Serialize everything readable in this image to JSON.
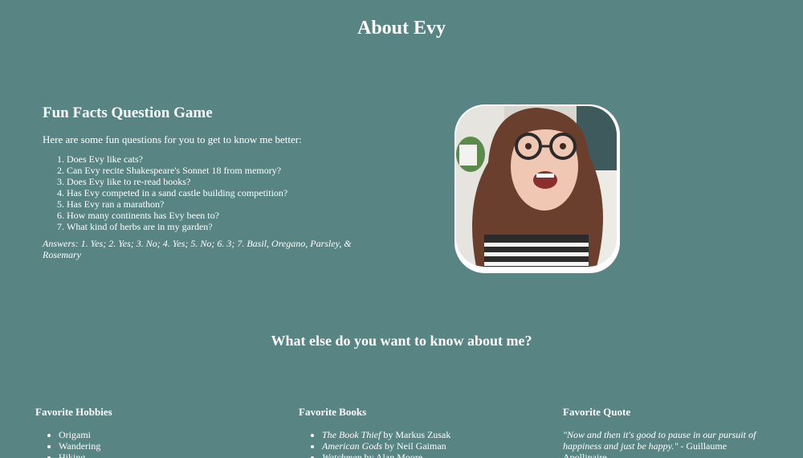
{
  "header": {
    "title": "About Evy"
  },
  "fun_facts": {
    "title": "Fun Facts Question Game",
    "intro": "Here are some fun questions for you to get to know me better:",
    "questions": [
      "Does Evy like cats?",
      "Can Evy recite Shakespeare's Sonnet 18 from memory?",
      "Does Evy like to re-read books?",
      "Has Evy competed in a sand castle building competition?",
      "Has Evy ran a marathon?",
      "How many continents has Evy been to?",
      "What kind of herbs are in my garden?"
    ],
    "answers": "Answers: 1. Yes; 2. Yes; 3. No; 4. Yes; 5. No; 6. 3; 7. Basil, Oregano, Parsley, & Rosemary"
  },
  "section_title": "What else do you want to know about me?",
  "hobbies": {
    "title": "Favorite Hobbies",
    "items": [
      "Origami",
      "Wandering",
      "Hiking"
    ]
  },
  "books": {
    "title": "Favorite Books",
    "items": [
      {
        "title": "The Book Thief",
        "author": " by Markus Zusak"
      },
      {
        "title": "American Gods",
        "author": " by Neil Gaiman"
      },
      {
        "title": "Watchmen",
        "author": " by Alan Moore"
      }
    ]
  },
  "quote": {
    "title": "Favorite Quote",
    "text": "\"Now and then it's good to pause in our pursuit of happiness and just be happy.\"",
    "attribution": " - Guillaume Apollinaire"
  },
  "colors": {
    "background": "#588584",
    "text": "#ffffff"
  }
}
